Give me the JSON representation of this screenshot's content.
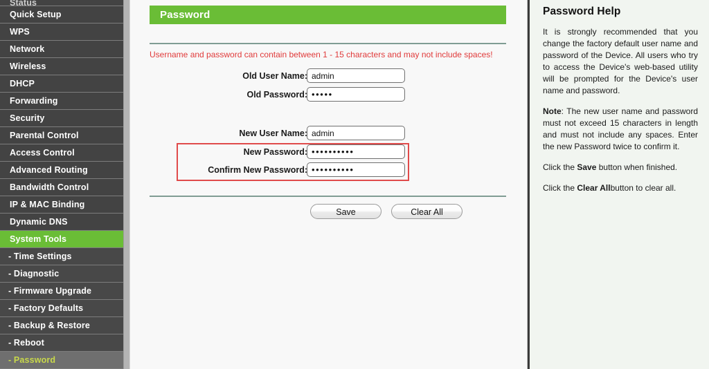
{
  "sidebar": {
    "partial_top_label": "Status",
    "items": [
      {
        "label": "Quick Setup",
        "type": "main",
        "state": "normal"
      },
      {
        "label": "WPS",
        "type": "main",
        "state": "normal"
      },
      {
        "label": "Network",
        "type": "main",
        "state": "normal"
      },
      {
        "label": "Wireless",
        "type": "main",
        "state": "normal"
      },
      {
        "label": "DHCP",
        "type": "main",
        "state": "normal"
      },
      {
        "label": "Forwarding",
        "type": "main",
        "state": "normal"
      },
      {
        "label": "Security",
        "type": "main",
        "state": "normal"
      },
      {
        "label": "Parental Control",
        "type": "main",
        "state": "normal"
      },
      {
        "label": "Access Control",
        "type": "main",
        "state": "normal"
      },
      {
        "label": "Advanced Routing",
        "type": "main",
        "state": "normal"
      },
      {
        "label": "Bandwidth Control",
        "type": "main",
        "state": "normal"
      },
      {
        "label": "IP & MAC Binding",
        "type": "main",
        "state": "normal"
      },
      {
        "label": "Dynamic DNS",
        "type": "main",
        "state": "normal"
      },
      {
        "label": "System Tools",
        "type": "main",
        "state": "active"
      },
      {
        "label": "- Time Settings",
        "type": "sub",
        "state": "normal"
      },
      {
        "label": "- Diagnostic",
        "type": "sub",
        "state": "normal"
      },
      {
        "label": "- Firmware Upgrade",
        "type": "sub",
        "state": "normal"
      },
      {
        "label": "- Factory Defaults",
        "type": "sub",
        "state": "normal"
      },
      {
        "label": "- Backup & Restore",
        "type": "sub",
        "state": "normal"
      },
      {
        "label": "- Reboot",
        "type": "sub",
        "state": "normal"
      },
      {
        "label": "- Password",
        "type": "sub",
        "state": "current"
      }
    ]
  },
  "main": {
    "banner_title": "Password",
    "warning": "Username and password can contain between 1 - 15 characters and may not include spaces!",
    "fields": [
      {
        "label": "Old User Name:",
        "value": "admin",
        "masked": false
      },
      {
        "label": "Old Password:",
        "value": "•••••",
        "masked": true
      },
      {
        "label": "New User Name:",
        "value": "admin",
        "masked": false
      },
      {
        "label": "New Password:",
        "value": "••••••••••",
        "masked": true
      },
      {
        "label": "Confirm New Password:",
        "value": "••••••••••",
        "masked": true
      }
    ],
    "buttons": {
      "save": "Save",
      "clear_all": "Clear All"
    }
  },
  "help": {
    "title": "Password Help",
    "p1": "It is strongly recommended that you change the factory default user name and password of the Device. All users who try to access the Device's web-based utility will be prompted for the Device's user name and password.",
    "p2_strong": "Note",
    "p2": ": The new user name and password must not exceed 15 characters in length and must not include any spaces. Enter the new Password twice to confirm it.",
    "p3_pre": "Click the ",
    "p3_strong": "Save",
    "p3_post": " button when finished.",
    "p4_pre": "Click the ",
    "p4_strong": "Clear All",
    "p4_post": "button to clear all."
  },
  "colors": {
    "accent_green": "#6abd36",
    "sidebar_dark": "#434343",
    "warning_red": "#e03a3a",
    "highlight_red": "#e04a4a",
    "help_bg": "#f1f5f0"
  }
}
